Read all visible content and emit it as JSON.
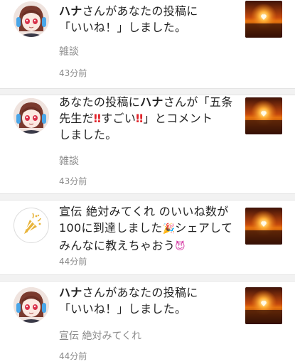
{
  "notifications": [
    {
      "user": "ハナ",
      "message_part": "さんがあなたの投稿に",
      "message_line2": "「いいね！」しました。",
      "tag": "雑談",
      "time": "43分前"
    },
    {
      "prefix": "あなたの投稿に",
      "user": "ハナ",
      "message_part": "さんが「五条",
      "line2_a": "先生だ",
      "line2_b": "すごい",
      "line2_c": "」とコメント",
      "line3": "しました。",
      "emoji_double_exclaim": "‼",
      "tag": "雑談",
      "time": "43分前"
    },
    {
      "line1": "宣伝 絶対みてくれ のいいね数が",
      "line2_a": "100に到達しました",
      "line2_b": "シェアして",
      "line3_a": "みんなに教えちゃおう",
      "emoji_party": "🎉",
      "emoji_devil": "😈",
      "time": "44分前"
    },
    {
      "user": "ハナ",
      "message_part": "さんがあなたの投稿に",
      "message_line2": "「いいね！」しました。",
      "tag": "宣伝 絶対みてくれ",
      "time": "44分前"
    }
  ],
  "icons": {
    "avatar": "anime-avatar-icon",
    "promo": "party-popper-icon",
    "thumbnail": "sunset-thumbnail"
  },
  "colors": {
    "divider": "#f2f2f2",
    "meta_text": "#8a8a8a",
    "emoji_red": "#e0242b",
    "popper_gold": "#e8b43a"
  }
}
